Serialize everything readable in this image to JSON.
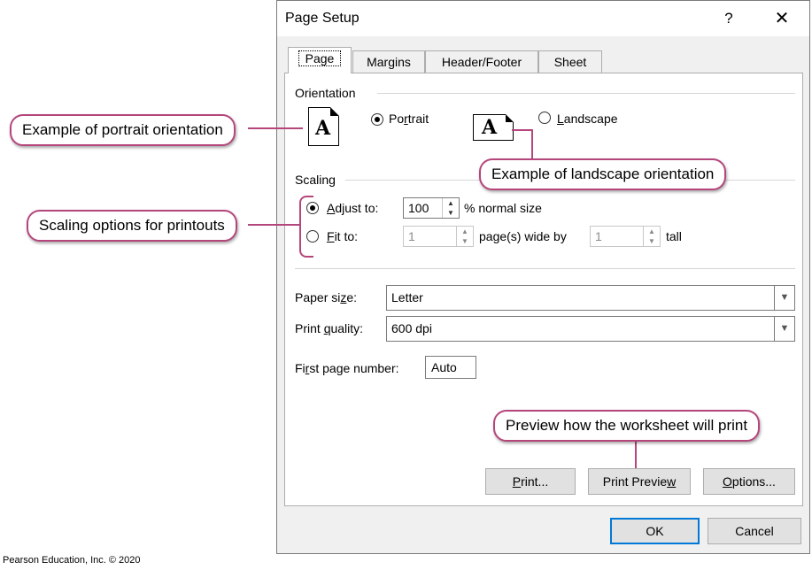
{
  "dialog": {
    "title": "Page Setup",
    "help": "?",
    "close": "✕",
    "tabs": [
      "Page",
      "Margins",
      "Header/Footer",
      "Sheet"
    ],
    "orientation": {
      "title": "Orientation",
      "portrait_label_pre": "Po",
      "portrait_label_mn": "r",
      "portrait_label_post": "trait",
      "landscape_label_pre": "",
      "landscape_label_mn": "L",
      "landscape_label_post": "andscape",
      "icon_letter": "A"
    },
    "scaling": {
      "title": "Scaling",
      "adjust_mn": "A",
      "adjust_rest": "djust to:",
      "adjust_value": "100",
      "normal_size": "% normal size",
      "fit_mn": "F",
      "fit_rest": "it to:",
      "fit_wide_value": "1",
      "pages_wide_by": "page(s) wide by",
      "fit_tall_value": "1",
      "tall": "tall"
    },
    "paper_size": {
      "label_pre": "Paper si",
      "label_mn": "z",
      "label_post": "e:",
      "value": "Letter"
    },
    "print_quality": {
      "label_pre": "Print ",
      "label_mn": "q",
      "label_post": "uality:",
      "value": "600 dpi"
    },
    "first_page": {
      "label_pre": "Fi",
      "label_mn": "r",
      "label_post": "st page number:",
      "value": "Auto"
    },
    "buttons": {
      "print_mn": "P",
      "print_rest": "rint...",
      "preview_pre": "Print Previe",
      "preview_mn": "w",
      "options_mn": "O",
      "options_rest": "ptions...",
      "ok": "OK",
      "cancel": "Cancel"
    }
  },
  "callouts": {
    "portrait": "Example of portrait orientation",
    "landscape": "Example of landscape orientation",
    "scaling": "Scaling options for printouts",
    "preview": "Preview how the worksheet will print"
  },
  "footer": "Pearson Education, Inc. © 2020",
  "colors": {
    "callout_border": "#b5467c",
    "ok_focus": "#0078d7"
  },
  "state": {
    "active_tab": "Page",
    "orientation": "Portrait",
    "scaling": "Adjust to"
  }
}
